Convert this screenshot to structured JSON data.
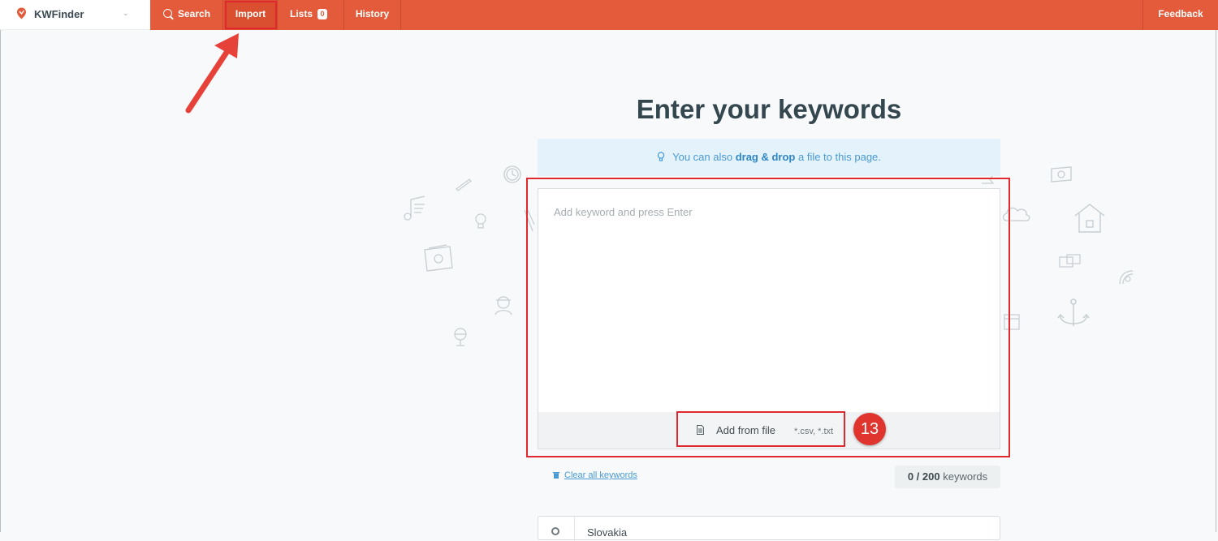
{
  "brand": {
    "name": "KWFinder"
  },
  "nav": {
    "search": "Search",
    "import": "Import",
    "lists": "Lists",
    "lists_count": "0",
    "history": "History",
    "feedback": "Feedback"
  },
  "main": {
    "title": "Enter your keywords",
    "hint_pre": "You can also ",
    "hint_bold": "drag & drop",
    "hint_post": " a file to this page.",
    "keyword_placeholder": "Add keyword and press Enter",
    "add_file_label": "Add from file",
    "add_file_ext": "*.csv, *.txt",
    "clear_label": "Clear all keywords",
    "counter_current": "0 / 200",
    "counter_unit": " keywords",
    "location_text": "Slovakia"
  },
  "annotation": {
    "step_number": "13"
  },
  "colors": {
    "nav_bg": "#e35b3a",
    "highlight_red": "#e0282f",
    "hint_bg": "#e3f2fb",
    "link_blue": "#4a9ad3"
  }
}
